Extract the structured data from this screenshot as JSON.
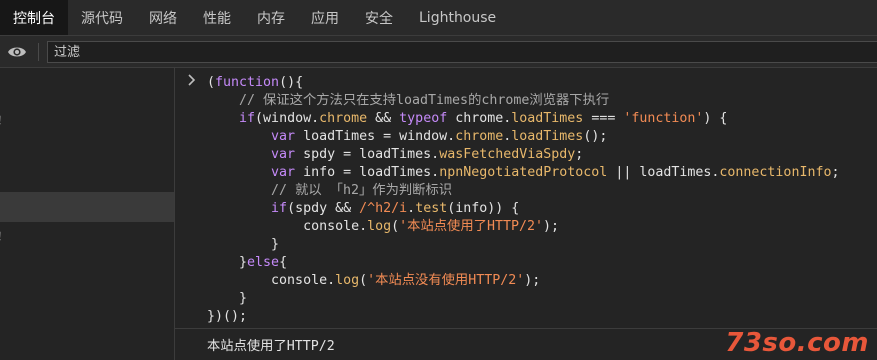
{
  "tabs": [
    {
      "label": "控制台"
    },
    {
      "label": "源代码"
    },
    {
      "label": "网络"
    },
    {
      "label": "性能"
    },
    {
      "label": "内存"
    },
    {
      "label": "应用"
    },
    {
      "label": "安全"
    },
    {
      "label": "Lighthouse"
    }
  ],
  "filter": {
    "placeholder": "过滤"
  },
  "sidebar": {
    "items": [
      {
        "label": "！"
      },
      {
        "label": ""
      },
      {
        "label": ""
      },
      {
        "label": ""
      },
      {
        "label": "！"
      }
    ]
  },
  "console": {
    "code_lines": [
      "(function(){",
      "    // 保证这个方法只在支持loadTimes的chrome浏览器下执行",
      "    if(window.chrome && typeof chrome.loadTimes === 'function') {",
      "        var loadTimes = window.chrome.loadTimes();",
      "        var spdy = loadTimes.wasFetchedViaSpdy;",
      "        var info = loadTimes.npnNegotiatedProtocol || loadTimes.connectionInfo;",
      "        // 就以 「h2」作为判断标识",
      "        if(spdy && /^h2/i.test(info)) {",
      "            console.log('本站点使用了HTTP/2');",
      "        }",
      "    }else{",
      "        console.log('本站点没有使用HTTP/2');",
      "    }",
      "})();"
    ],
    "output": "本站点使用了HTTP/2"
  },
  "watermark": "73so.com",
  "colors": {
    "keyword": "#c58af9",
    "property": "#e8b86b",
    "string": "#f28b54",
    "comment": "#a8a8a8",
    "watermark": "#e8573a"
  }
}
